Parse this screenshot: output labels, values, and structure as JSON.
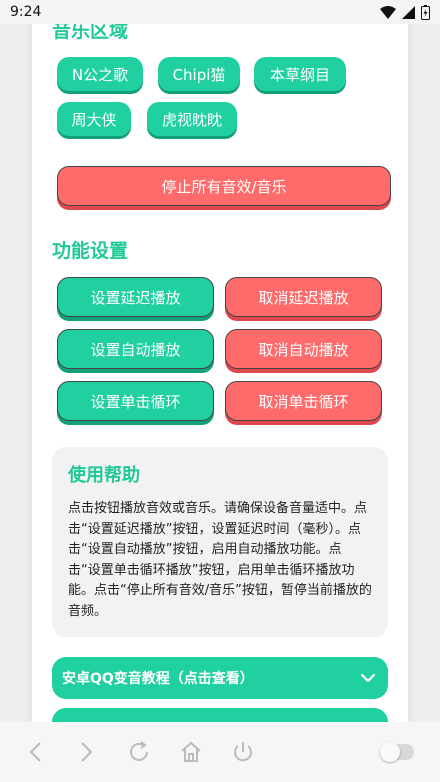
{
  "status_bar": {
    "time": "9:24"
  },
  "music_section": {
    "title": "音乐区域",
    "chips": [
      "N公之歌",
      "Chipi猫",
      "本草纲目",
      "周大侠",
      "虎视眈眈"
    ]
  },
  "stop_all_label": "停止所有音效/音乐",
  "function_section": {
    "title": "功能设置",
    "set_delay": "设置延迟播放",
    "cancel_delay": "取消延迟播放",
    "set_auto": "设置自动播放",
    "cancel_auto": "取消自动播放",
    "set_loop": "设置单击循环",
    "cancel_loop": "取消单击循环"
  },
  "help": {
    "title": "使用帮助",
    "text": "点击按钮播放音效或音乐。请确保设备音量适中。点击“设置延迟播放”按钮，设置延迟时间（毫秒）。点击“设置自动播放”按钮，启用自动播放功能。点击“设置单击循环播放”按钮，启用单击循环播放功能。点击“停止所有音效/音乐”按钮，暂停当前播放的音频。"
  },
  "accordion": {
    "tutorial_label": "安卓QQ变音教程（点击查看）"
  },
  "colors": {
    "accent": "#20d0a0",
    "danger": "#ff6b6b",
    "title": "#20c997"
  }
}
